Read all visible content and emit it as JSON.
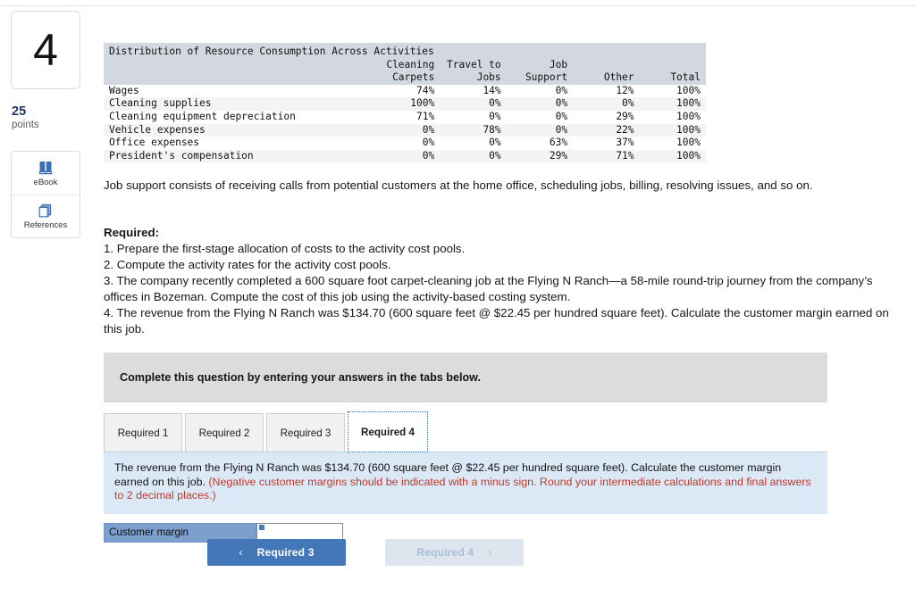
{
  "sidebar": {
    "question_number": "4",
    "points_value": "25",
    "points_label": "points",
    "tools": [
      {
        "name": "ebook",
        "label": "eBook",
        "icon": "book-icon"
      },
      {
        "name": "references",
        "label": "References",
        "icon": "pages-icon"
      }
    ]
  },
  "table": {
    "title": "Distribution of Resource Consumption Across Activities",
    "columns_line1": [
      "",
      "Cleaning",
      "Travel to",
      "Job",
      "",
      ""
    ],
    "columns_line2": [
      "",
      "Carpets",
      "Jobs",
      "Support",
      "Other",
      "Total"
    ],
    "rows": [
      {
        "label": "Wages",
        "cleaning_carpets": "74%",
        "travel_to_jobs": "14%",
        "job_support": "0%",
        "other": "12%",
        "total": "100%"
      },
      {
        "label": "Cleaning supplies",
        "cleaning_carpets": "100%",
        "travel_to_jobs": "0%",
        "job_support": "0%",
        "other": "0%",
        "total": "100%"
      },
      {
        "label": "Cleaning equipment depreciation",
        "cleaning_carpets": "71%",
        "travel_to_jobs": "0%",
        "job_support": "0%",
        "other": "29%",
        "total": "100%"
      },
      {
        "label": "Vehicle expenses",
        "cleaning_carpets": "0%",
        "travel_to_jobs": "78%",
        "job_support": "0%",
        "other": "22%",
        "total": "100%"
      },
      {
        "label": "Office expenses",
        "cleaning_carpets": "0%",
        "travel_to_jobs": "0%",
        "job_support": "63%",
        "other": "37%",
        "total": "100%"
      },
      {
        "label": "President's compensation",
        "cleaning_carpets": "0%",
        "travel_to_jobs": "0%",
        "job_support": "29%",
        "other": "71%",
        "total": "100%"
      }
    ]
  },
  "body": {
    "job_support_paragraph": "Job support consists of receiving calls from potential customers at the home office, scheduling jobs, billing, resolving issues, and so on.",
    "required_heading": "Required:",
    "required_items": [
      "1. Prepare the first-stage allocation of costs to the activity cost pools.",
      "2. Compute the activity rates for the activity cost pools.",
      "3. The company recently completed a 600 square foot carpet-cleaning job at the Flying N Ranch—a 58-mile round-trip journey from the company’s offices in Bozeman. Compute the cost of this job using the activity-based costing system.",
      "4. The revenue from the Flying N Ranch was $134.70 (600 square feet @ $22.45 per hundred square feet). Calculate the customer margin earned on this job."
    ]
  },
  "question_panel": {
    "complete_banner": "Complete this question by entering your answers in the tabs below.",
    "tabs": [
      {
        "label": "Required 1",
        "active": false
      },
      {
        "label": "Required 2",
        "active": false
      },
      {
        "label": "Required 3",
        "active": false
      },
      {
        "label": "Required 4",
        "active": true
      }
    ],
    "instruction_main": "The revenue from the Flying N Ranch was $134.70 (600 square feet @ $22.45 per hundred square feet). Calculate the customer margin earned on this job.",
    "instruction_hint": "(Negative customer margins should be indicated with a minus sign. Round your intermediate calculations and final answers to 2 decimal places.)",
    "answer": {
      "label": "Customer margin",
      "value": "",
      "placeholder": ""
    }
  },
  "navigation": {
    "prev_label": "Required 3",
    "prev_chevron": "‹",
    "next_label": "Required 4",
    "next_chevron": "›"
  },
  "colors": {
    "accent_blue": "#4477b8",
    "table_header": "#d3d8e0",
    "instruction_bg": "#dbe9f7",
    "hint_red": "#c0392b",
    "answer_label_bg": "#7d9fce",
    "banner_gray": "#dcdcdc"
  }
}
